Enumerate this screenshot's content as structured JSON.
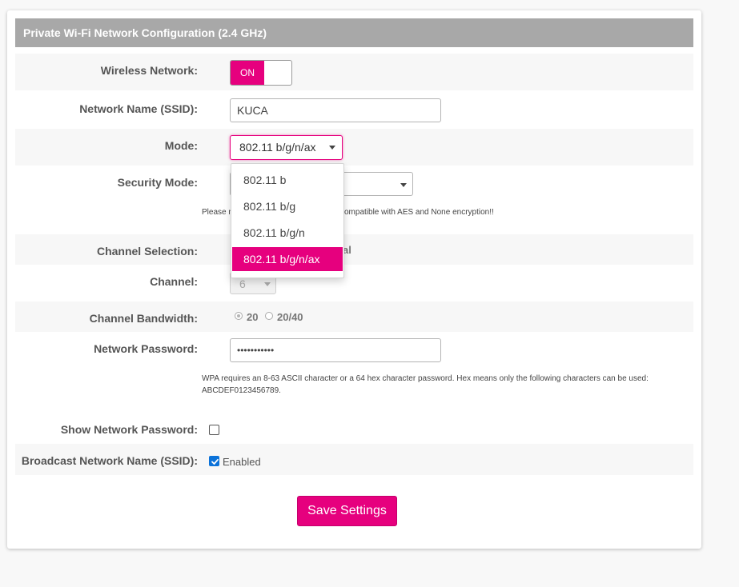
{
  "header": {
    "title": "Private Wi-Fi Network Configuration (2.4 GHz)"
  },
  "wireless": {
    "label": "Wireless Network:",
    "toggle_state": "ON"
  },
  "ssid": {
    "label": "Network Name (SSID):",
    "value": "KUCA"
  },
  "mode": {
    "label": "Mode:",
    "selected": "802.11 b/g/n/ax",
    "options": [
      "802.11 b",
      "802.11 b/g",
      "802.11 b/g/n",
      "802.11 b/g/n/ax"
    ]
  },
  "security": {
    "label": "Security Mode:",
    "hint_left": "Please n",
    "hint_right": "ompatible with AES and None encryption!!"
  },
  "channel_selection": {
    "label": "Channel Selection:",
    "partial_text": "al"
  },
  "channel": {
    "label": "Channel:",
    "value": "6"
  },
  "bandwidth": {
    "label": "Channel Bandwidth:",
    "options": [
      "20",
      "20/40"
    ],
    "selected": "20"
  },
  "password": {
    "label": "Network Password:",
    "value": "•••••••••••",
    "hint_line1": "WPA requires an 8-63 ASCII character or a 64 hex character password. Hex means only the following characters can be used:",
    "hint_line2": "ABCDEF0123456789."
  },
  "show_password": {
    "label": "Show Network Password:",
    "checked": false
  },
  "broadcast": {
    "label": "Broadcast Network Name (SSID):",
    "checked": true,
    "checkbox_label": "Enabled"
  },
  "actions": {
    "save_label": "Save Settings"
  },
  "colors": {
    "accent": "#e6007e",
    "header_bg": "#a8a8a8",
    "row_alt_bg": "#f7f7f7",
    "checkbox_blue": "#0b72d9"
  },
  "icons": {
    "dropdown": "caret-down-icon",
    "check": "checkmark-icon"
  }
}
